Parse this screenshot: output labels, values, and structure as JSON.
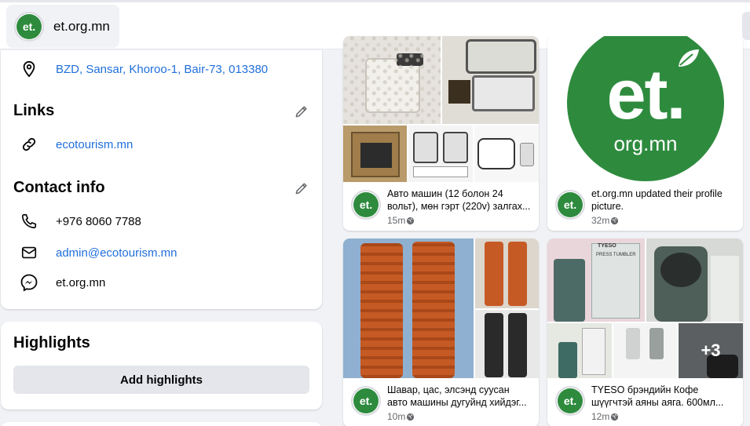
{
  "header": {
    "page_name": "et.org.mn",
    "logo_text": "et.",
    "logo_sub": "org.mn"
  },
  "about": {
    "address": "BZD, Sansar, Khoroo-1, Bair-73, 013380",
    "links_title": "Links",
    "website": "ecotourism.mn",
    "contact_title": "Contact info",
    "phone": "+976 8060 7788",
    "email": "admin@ecotourism.mn",
    "messenger": "et.org.mn"
  },
  "highlights": {
    "title": "Highlights",
    "button": "Add highlights"
  },
  "posts": [
    {
      "caption": "Авто машин (12 болон 24 вольт), мөн гэрт (220v) залгах...",
      "time": "15m"
    },
    {
      "caption": "et.org.mn updated their profile picture.",
      "time": "32m",
      "logo_text": "et.",
      "logo_sub": "org.mn"
    },
    {
      "caption": "Шавар, цас, элсэнд суусан авто машины дугуйнд хийдэг...",
      "time": "10m"
    },
    {
      "caption": "TYESO брэндийн Кофе шүүгчтэй аяны аяга. 600мл...",
      "time": "12m",
      "more": "+3",
      "brand": "TYESO",
      "product": "PRESS TUMBLER"
    }
  ],
  "colors": {
    "brand_green": "#2e8b3e",
    "link_blue": "#216fdb",
    "muted": "#65676b"
  }
}
